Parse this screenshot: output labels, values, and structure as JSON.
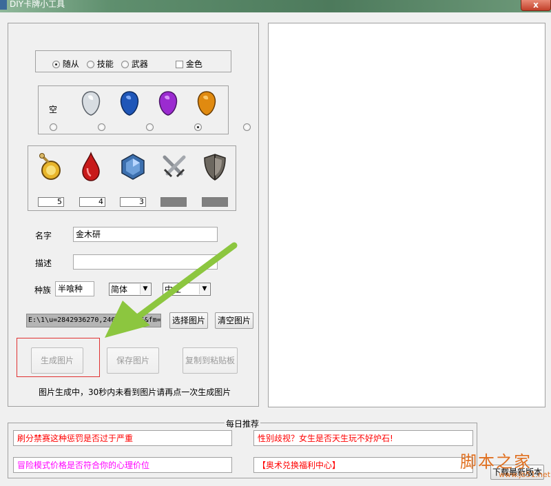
{
  "window": {
    "title": "DIY卡牌小工具",
    "close_label": "x"
  },
  "card_type": {
    "options": [
      {
        "label": "随从",
        "checked": true
      },
      {
        "label": "技能",
        "checked": false
      },
      {
        "label": "武器",
        "checked": false
      }
    ],
    "golden": {
      "label": "金色",
      "checked": false
    }
  },
  "rarity": {
    "empty_label": "空",
    "selected": "purple"
  },
  "stats": {
    "cost": "5",
    "attack": "4",
    "health": "3",
    "weapon_attack": "",
    "durability": ""
  },
  "form": {
    "name_label": "名字",
    "name_value": "金木研",
    "desc_label": "描述",
    "desc_value": "",
    "race_label": "种族",
    "race_value": "半喰种",
    "lang_value": "简体",
    "class_value": "中立"
  },
  "image": {
    "path": "E:\\1\\u=2842936270,2465289026&fm=",
    "select_label": "选择图片",
    "clear_label": "清空图片"
  },
  "actions": {
    "generate_label": "生成图片",
    "save_label": "保存图片",
    "copy_label": "复制到粘贴板",
    "hint": "图片生成中，30秒内未看到图片请再点一次生成图片"
  },
  "daily": {
    "title": "每日推荐",
    "links": [
      {
        "text": "刷分禁赛这种惩罚是否过于严重",
        "color": "#ff0000"
      },
      {
        "text": "性别歧视？女生是否天生玩不好炉石!",
        "color": "#ff0000"
      },
      {
        "text": "冒险模式价格是否符合你的心理价位",
        "color": "#ff00ff"
      },
      {
        "text": "【奥术兑换福利中心】",
        "color": "#ff0000"
      }
    ],
    "download_label": "下载最新版本"
  },
  "watermark": {
    "text": "脚本之家",
    "url": "www.jb51.net"
  },
  "colors": {
    "arrow": "#8cc63f",
    "highlight_border": "#e03030",
    "gem_white": "#d8dde2",
    "gem_blue": "#1f56b8",
    "gem_purple": "#9b2bd0",
    "gem_orange": "#e08a10"
  }
}
